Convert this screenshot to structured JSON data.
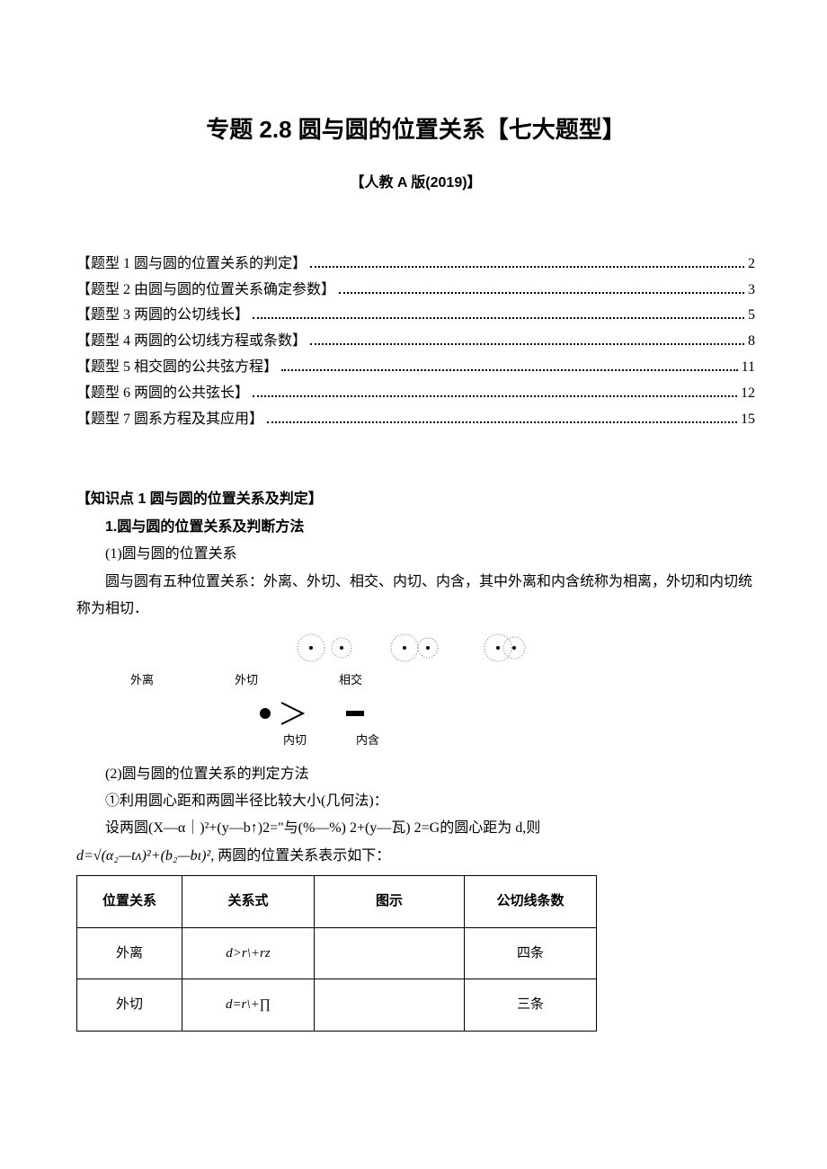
{
  "title": "专题 2.8 圆与圆的位置关系【七大题型】",
  "subtitle": "【人教 A 版(2019)】",
  "toc": [
    {
      "label": "【题型 1 圆与圆的位置关系的判定】",
      "page": "2"
    },
    {
      "label": "【题型 2 由圆与圆的位置关系确定参数】",
      "page": "3"
    },
    {
      "label": "【题型 3 两圆的公切线长】",
      "page": "5"
    },
    {
      "label": "【题型 4 两圆的公切线方程或条数】",
      "page": "8"
    },
    {
      "label": "【题型 5 相交圆的公共弦方程】",
      "page": "11"
    },
    {
      "label": "【题型 6 两圆的公共弦长】",
      "page": "12"
    },
    {
      "label": "【题型 7 圆系方程及其应用】",
      "page": "15"
    }
  ],
  "knowledge": {
    "head": "【知识点 1 圆与圆的位置关系及判定】",
    "main1": "1.圆与圆的位置关系及判断方法",
    "p1_label": "(1)圆与圆的位置关系",
    "p1_body": "圆与圆有五种位置关系：外离、外切、相交、内切、内含，其中外离和内含统称为相离，外切和内切统称为相切．",
    "figlabels1": [
      "外离",
      "外切",
      "相交"
    ],
    "figlabels2": [
      "内切",
      "内含"
    ],
    "p2_label": "(2)圆与圆的位置关系的判定方法",
    "p2_1": "①利用圆心距和两圆半径比较大小(几何法)：",
    "p2_2": "设两圆(X—α｜)²+(y—b↑)2=\"与(%—%) 2+(y—瓦) 2=G的圆心距为 d,则",
    "p2_3_prefix": "d=√(α₂—tʌ)²+(b₂—bι)²",
    "p2_3_suffix": ", 两圆的位置关系表示如下：",
    "table": {
      "headers": [
        "位置关系",
        "关系式",
        "图示",
        "公切线条数"
      ],
      "rows": [
        {
          "c1": "外离",
          "c2": "d>r\\+rz",
          "c3": "",
          "c4": "四条"
        },
        {
          "c1": "外切",
          "c2": "d=r\\+∏",
          "c3": "",
          "c4": "三条"
        }
      ]
    }
  }
}
